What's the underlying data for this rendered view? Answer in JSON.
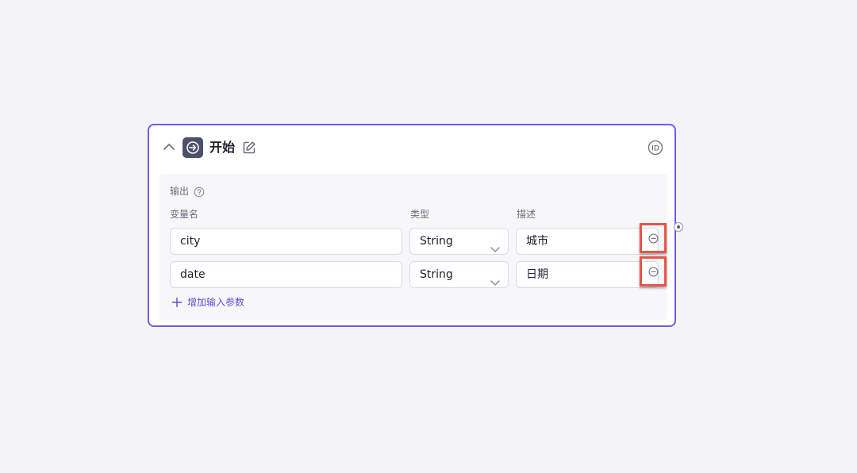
{
  "node": {
    "title": "开始",
    "icons": {
      "collapse": "chevron-up-icon",
      "node_type": "start-arrow-icon",
      "edit": "edit-icon",
      "id": "id-icon"
    },
    "id_label": "ID"
  },
  "output": {
    "label": "输出",
    "help_icon": "help-circle-icon",
    "columns": {
      "name": "变量名",
      "type": "类型",
      "desc": "描述"
    },
    "params": [
      {
        "name": "city",
        "type": "String",
        "desc": "城市"
      },
      {
        "name": "date",
        "type": "String",
        "desc": "日期"
      }
    ],
    "add_label": "增加输入参数"
  },
  "colors": {
    "accent": "#6c5ce7",
    "highlight_border": "#e85547",
    "link": "#5b4fd9",
    "background": "#f4f3f8"
  }
}
